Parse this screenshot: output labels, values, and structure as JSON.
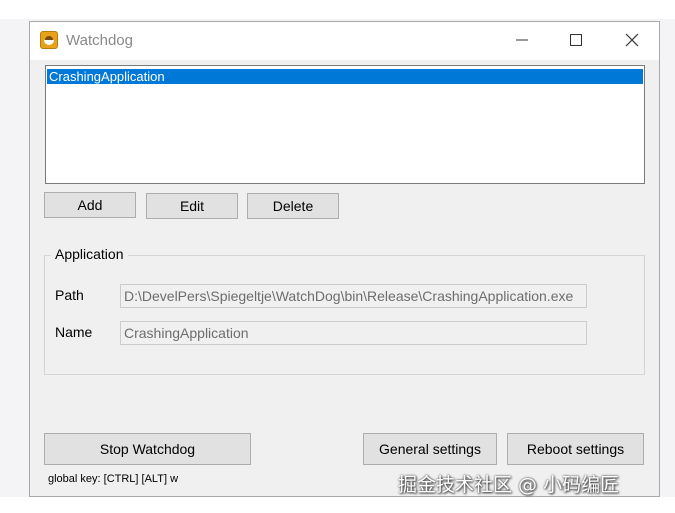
{
  "window": {
    "title": "Watchdog",
    "icon": "app-watchdog-icon"
  },
  "applications": {
    "items": [
      {
        "label": "CrashingApplication",
        "selected": true
      }
    ]
  },
  "toolbar": {
    "add_label": "Add",
    "edit_label": "Edit",
    "delete_label": "Delete"
  },
  "application_group": {
    "legend": "Application",
    "path_label": "Path",
    "path_value": "D:\\DevelPers\\Spiegeltje\\WatchDog\\bin\\Release\\CrashingApplication.exe",
    "name_label": "Name",
    "name_value": "CrashingApplication"
  },
  "footer": {
    "stop_label": "Stop Watchdog",
    "general_label": "General settings",
    "reboot_label": "Reboot settings",
    "hotkey_text": "global key:  [CTRL] [ALT] w"
  },
  "watermark": {
    "text": "掘金技术社区 @ 小码编匠"
  },
  "colors": {
    "selection": "#0078d7",
    "window_bg": "#f0f0f0",
    "button_bg": "#e1e1e1"
  }
}
